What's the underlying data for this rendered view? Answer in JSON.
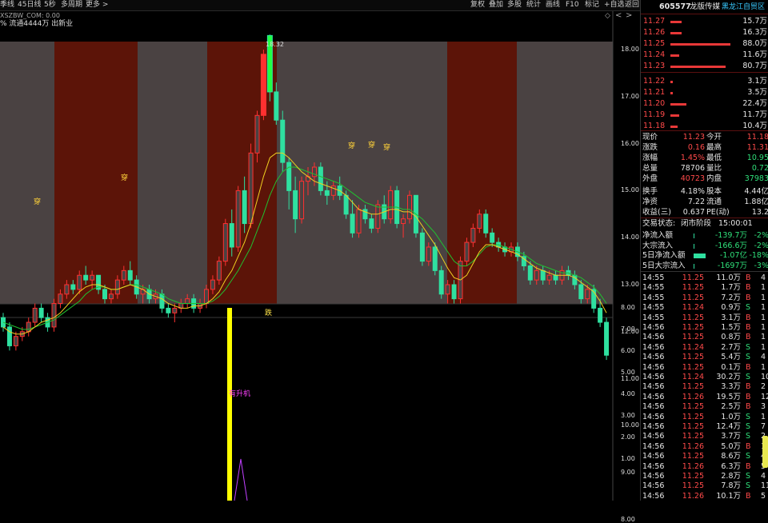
{
  "toolbar": {
    "items_left": [
      "季线",
      "45日线",
      "5秒",
      "多周期",
      "更多 >"
    ],
    "items_right": [
      "复权",
      "叠加",
      "多股",
      "统计",
      "画线",
      "F10",
      "标记",
      "+自选",
      "返回"
    ]
  },
  "formula_line": "XSZBW_COM: 0.00",
  "info_line": "% 流通4444万 出新业",
  "chart": {
    "high_label": "18.32",
    "signal_label": "穿",
    "divider_label": "跌",
    "indicator_label": "有升机",
    "price_ticks": [
      "18.00",
      "17.00",
      "16.00",
      "15.00",
      "14.00",
      "13.00",
      "12.00",
      "11.00",
      "10.00",
      "9.00",
      "8.00"
    ],
    "ind_ticks": [
      "8.00",
      "7.00",
      "6.00",
      "5.00",
      "4.00",
      "3.00",
      "2.00",
      "1.00"
    ]
  },
  "chart_data": {
    "type": "candlestick",
    "ylim": [
      7.5,
      19.0
    ],
    "ohlc": [
      [
        12.3,
        12.4,
        12.0,
        12.1
      ],
      [
        12.1,
        12.2,
        11.6,
        11.7
      ],
      [
        11.7,
        12.0,
        11.6,
        11.9
      ],
      [
        11.9,
        12.1,
        11.8,
        12.0
      ],
      [
        12.0,
        12.3,
        11.9,
        12.2
      ],
      [
        12.2,
        12.6,
        12.1,
        12.5
      ],
      [
        12.5,
        12.6,
        12.2,
        12.3
      ],
      [
        12.3,
        12.4,
        12.0,
        12.1
      ],
      [
        12.1,
        12.7,
        12.0,
        12.6
      ],
      [
        12.6,
        12.9,
        12.5,
        12.8
      ],
      [
        12.8,
        13.1,
        12.7,
        13.0
      ],
      [
        13.0,
        13.1,
        12.8,
        12.9
      ],
      [
        12.9,
        13.3,
        12.8,
        13.2
      ],
      [
        13.2,
        13.4,
        13.0,
        13.1
      ],
      [
        13.1,
        13.3,
        12.9,
        13.2
      ],
      [
        13.2,
        13.2,
        12.8,
        12.9
      ],
      [
        12.9,
        13.0,
        12.6,
        12.7
      ],
      [
        12.7,
        12.9,
        12.6,
        12.8
      ],
      [
        12.8,
        13.2,
        12.7,
        13.1
      ],
      [
        13.1,
        13.4,
        13.0,
        13.3
      ],
      [
        13.3,
        13.5,
        13.0,
        13.1
      ],
      [
        13.1,
        13.2,
        12.7,
        12.8
      ],
      [
        12.8,
        13.0,
        12.6,
        12.9
      ],
      [
        12.9,
        13.0,
        12.6,
        12.7
      ],
      [
        12.7,
        12.9,
        12.6,
        12.8
      ],
      [
        12.8,
        12.9,
        12.4,
        12.5
      ],
      [
        12.5,
        12.6,
        12.3,
        12.4
      ],
      [
        12.4,
        12.6,
        12.2,
        12.5
      ],
      [
        12.5,
        12.7,
        12.4,
        12.6
      ],
      [
        12.6,
        12.8,
        12.5,
        12.7
      ],
      [
        12.7,
        12.8,
        12.4,
        12.5
      ],
      [
        12.5,
        12.7,
        12.4,
        12.6
      ],
      [
        12.6,
        13.0,
        12.5,
        12.9
      ],
      [
        12.9,
        13.2,
        12.8,
        13.1
      ],
      [
        13.1,
        13.6,
        13.0,
        13.5
      ],
      [
        13.5,
        14.4,
        13.4,
        14.3
      ],
      [
        14.3,
        14.6,
        13.6,
        13.8
      ],
      [
        13.8,
        15.1,
        13.7,
        15.0
      ],
      [
        15.0,
        15.3,
        14.1,
        14.3
      ],
      [
        14.3,
        16.0,
        14.2,
        15.8
      ],
      [
        15.8,
        16.7,
        15.6,
        16.6
      ],
      [
        16.6,
        18.0,
        16.5,
        17.9
      ],
      [
        18.3,
        18.32,
        16.9,
        17.1
      ],
      [
        17.1,
        17.3,
        16.4,
        16.5
      ],
      [
        16.5,
        16.7,
        15.4,
        15.6
      ],
      [
        15.6,
        15.7,
        14.6,
        15.0
      ],
      [
        15.0,
        15.3,
        14.1,
        14.4
      ],
      [
        14.4,
        15.3,
        14.3,
        15.2
      ],
      [
        15.2,
        15.5,
        14.9,
        15.3
      ],
      [
        15.3,
        15.6,
        15.1,
        15.5
      ],
      [
        15.5,
        15.6,
        14.9,
        15.0
      ],
      [
        15.0,
        15.2,
        14.7,
        14.9
      ],
      [
        14.9,
        15.2,
        14.8,
        15.1
      ],
      [
        15.1,
        15.3,
        14.8,
        14.9
      ],
      [
        14.9,
        15.0,
        14.4,
        14.5
      ],
      [
        14.5,
        14.8,
        14.0,
        14.1
      ],
      [
        14.1,
        14.7,
        14.0,
        14.6
      ],
      [
        14.6,
        14.7,
        14.3,
        14.4
      ],
      [
        14.4,
        14.5,
        14.1,
        14.2
      ],
      [
        14.2,
        14.8,
        14.1,
        14.7
      ],
      [
        14.7,
        14.9,
        14.3,
        14.4
      ],
      [
        14.4,
        15.1,
        14.3,
        15.0
      ],
      [
        15.0,
        15.1,
        14.2,
        14.3
      ],
      [
        14.3,
        14.5,
        14.0,
        14.4
      ],
      [
        14.4,
        15.0,
        14.3,
        14.9
      ],
      [
        14.9,
        14.9,
        14.0,
        14.1
      ],
      [
        14.1,
        14.2,
        13.4,
        13.5
      ],
      [
        13.5,
        13.9,
        13.4,
        13.8
      ],
      [
        13.8,
        13.9,
        13.2,
        13.3
      ],
      [
        13.3,
        13.4,
        12.7,
        12.8
      ],
      [
        12.8,
        13.1,
        12.6,
        13.0
      ],
      [
        13.0,
        13.1,
        12.6,
        12.7
      ],
      [
        12.7,
        13.6,
        12.6,
        13.5
      ],
      [
        13.5,
        14.0,
        13.4,
        13.9
      ],
      [
        13.9,
        14.3,
        13.8,
        14.2
      ],
      [
        14.2,
        14.6,
        14.1,
        14.5
      ],
      [
        14.5,
        14.6,
        14.0,
        14.1
      ],
      [
        14.1,
        14.2,
        13.8,
        13.9
      ],
      [
        13.9,
        14.0,
        13.7,
        13.8
      ],
      [
        13.8,
        13.9,
        13.6,
        13.7
      ],
      [
        13.7,
        13.9,
        13.6,
        13.8
      ],
      [
        13.8,
        13.9,
        13.5,
        13.6
      ],
      [
        13.6,
        13.7,
        13.3,
        13.4
      ],
      [
        13.4,
        13.5,
        13.0,
        13.1
      ],
      [
        13.1,
        13.4,
        13.0,
        13.3
      ],
      [
        13.3,
        13.4,
        13.0,
        13.1
      ],
      [
        13.1,
        13.3,
        13.0,
        13.2
      ],
      [
        13.2,
        13.3,
        13.0,
        13.1
      ],
      [
        13.1,
        13.4,
        13.0,
        13.3
      ],
      [
        13.3,
        13.4,
        13.1,
        13.2
      ],
      [
        13.2,
        13.3,
        12.9,
        13.0
      ],
      [
        13.0,
        13.1,
        12.6,
        12.7
      ],
      [
        12.7,
        13.0,
        12.6,
        12.9
      ],
      [
        12.9,
        13.0,
        12.4,
        12.5
      ],
      [
        12.5,
        12.7,
        12.1,
        12.2
      ],
      [
        12.2,
        12.3,
        11.4,
        11.5
      ]
    ],
    "ma_fast": [
      12.1,
      12.0,
      11.95,
      11.95,
      12.0,
      12.1,
      12.2,
      12.25,
      12.3,
      12.4,
      12.55,
      12.7,
      12.85,
      12.95,
      13.0,
      13.0,
      12.95,
      12.9,
      12.9,
      12.95,
      13.0,
      12.95,
      12.9,
      12.8,
      12.75,
      12.7,
      12.6,
      12.55,
      12.5,
      12.5,
      12.55,
      12.55,
      12.6,
      12.7,
      12.85,
      13.1,
      13.3,
      13.6,
      13.9,
      14.3,
      14.8,
      15.3,
      15.7,
      15.8,
      15.8,
      15.7,
      15.55,
      15.4,
      15.3,
      15.2,
      15.15,
      15.1,
      15.05,
      15.0,
      14.9,
      14.75,
      14.6,
      14.55,
      14.5,
      14.5,
      14.55,
      14.6,
      14.6,
      14.55,
      14.55,
      14.45,
      14.25,
      14.05,
      13.85,
      13.6,
      13.35,
      13.15,
      13.1,
      13.2,
      13.45,
      13.7,
      13.85,
      13.85,
      13.8,
      13.75,
      13.7,
      13.65,
      13.55,
      13.45,
      13.35,
      13.3,
      13.25,
      13.2,
      13.2,
      13.2,
      13.15,
      13.05,
      12.95,
      12.85,
      12.65,
      12.4
    ],
    "ma_slow": [
      12.2,
      12.15,
      12.1,
      12.05,
      12.05,
      12.1,
      12.15,
      12.2,
      12.25,
      12.35,
      12.45,
      12.55,
      12.65,
      12.8,
      12.9,
      12.95,
      12.95,
      12.9,
      12.9,
      12.95,
      13.0,
      13.0,
      12.95,
      12.9,
      12.85,
      12.8,
      12.7,
      12.65,
      12.6,
      12.6,
      12.6,
      12.6,
      12.6,
      12.65,
      12.75,
      12.9,
      13.1,
      13.3,
      13.55,
      13.8,
      14.15,
      14.5,
      14.9,
      15.2,
      15.4,
      15.5,
      15.5,
      15.45,
      15.4,
      15.35,
      15.3,
      15.25,
      15.2,
      15.15,
      15.05,
      14.95,
      14.85,
      14.75,
      14.7,
      14.65,
      14.65,
      14.65,
      14.65,
      14.6,
      14.6,
      14.5,
      14.4,
      14.25,
      14.1,
      13.9,
      13.7,
      13.5,
      13.4,
      13.4,
      13.5,
      13.65,
      13.8,
      13.85,
      13.85,
      13.8,
      13.75,
      13.7,
      13.65,
      13.55,
      13.45,
      13.4,
      13.35,
      13.3,
      13.25,
      13.25,
      13.2,
      13.15,
      13.05,
      12.95,
      12.8,
      12.6
    ],
    "bands": [
      [
        68,
        172
      ],
      [
        259,
        346
      ],
      [
        559,
        646
      ]
    ],
    "indicator": {
      "spike_x": 287,
      "spike_value": 8.0,
      "triangle_x": 301,
      "triangle_value": 1.0,
      "ylim": [
        0,
        8.6
      ]
    }
  },
  "quote": {
    "code": "605577",
    "name": "龙版传媒",
    "region": "黑龙江自贸区",
    "sells": [
      {
        "price": "11.27",
        "vol": "15.7万",
        "bar": 0.18
      },
      {
        "price": "11.26",
        "vol": "16.3万",
        "bar": 0.19
      },
      {
        "price": "11.25",
        "vol": "88.0万",
        "bar": 1.0
      },
      {
        "price": "11.24",
        "vol": "11.6万",
        "bar": 0.14
      },
      {
        "price": "11.23",
        "vol": "80.7万",
        "bar": 0.92
      }
    ],
    "buys": [
      {
        "price": "11.22",
        "vol": "3.1万",
        "bar": 0.04
      },
      {
        "price": "11.21",
        "vol": "3.5万",
        "bar": 0.04
      },
      {
        "price": "11.20",
        "vol": "22.4万",
        "bar": 0.26
      },
      {
        "price": "11.19",
        "vol": "11.7万",
        "bar": 0.14
      },
      {
        "price": "11.18",
        "vol": "10.4万",
        "bar": 0.12
      }
    ],
    "stats": [
      {
        "l1": "现价",
        "v1": "11.23",
        "c1": "red",
        "l2": "今开",
        "v2": "11.18",
        "c2": "red"
      },
      {
        "l1": "涨跌",
        "v1": "0.16",
        "c1": "red",
        "l2": "最高",
        "v2": "11.31",
        "c2": "red"
      },
      {
        "l1": "涨幅",
        "v1": "1.45%",
        "c1": "red",
        "l2": "最低",
        "v2": "10.95",
        "c2": "green"
      },
      {
        "l1": "总量",
        "v1": "78706",
        "c1": "white",
        "l2": "量比",
        "v2": "0.72",
        "c2": "green"
      },
      {
        "l1": "外盘",
        "v1": "40723",
        "c1": "red",
        "l2": "内盘",
        "v2": "37983",
        "c2": "green"
      },
      {
        "l1": "换手",
        "v1": "4.18%",
        "c1": "white",
        "l2": "股本",
        "v2": "4.44亿",
        "c2": "white"
      },
      {
        "l1": "净资",
        "v1": "7.22",
        "c1": "white",
        "l2": "流通",
        "v2": "1.88亿",
        "c2": "white"
      },
      {
        "l1": "收益(三)",
        "v1": "0.637",
        "c1": "white",
        "l2": "PE(动)",
        "v2": "13.2",
        "c2": "white"
      }
    ],
    "status_label": "交易状态:",
    "status_value": "闭市阶段",
    "status_time": "15:00:01",
    "flows": [
      {
        "label": "净流入额",
        "value": "-139.7万",
        "pct": "-2%",
        "bar": 0
      },
      {
        "label": "大宗流入",
        "value": "-166.6万",
        "pct": "-2%",
        "bar": 0
      },
      {
        "label": "5日净流入额",
        "value": "-1.07亿",
        "pct": "-18%",
        "bar": 1
      },
      {
        "label": "5日大宗流入",
        "value": "-1697万",
        "pct": "-3%",
        "bar": 0
      }
    ],
    "ticks": [
      {
        "t": "14:55",
        "p": "11.25",
        "v": "11.0万",
        "s": "B",
        "n": "4"
      },
      {
        "t": "14:55",
        "p": "11.25",
        "v": "1.7万",
        "s": "B",
        "n": "1"
      },
      {
        "t": "14:55",
        "p": "11.25",
        "v": "7.2万",
        "s": "B",
        "n": "1"
      },
      {
        "t": "14:55",
        "p": "11.24",
        "v": "0.9万",
        "s": "S",
        "n": "1"
      },
      {
        "t": "14:55",
        "p": "11.25",
        "v": "3.1万",
        "s": "B",
        "n": "1"
      },
      {
        "t": "14:56",
        "p": "11.25",
        "v": "1.5万",
        "s": "B",
        "n": "1"
      },
      {
        "t": "14:56",
        "p": "11.25",
        "v": "0.8万",
        "s": "B",
        "n": "1"
      },
      {
        "t": "14:56",
        "p": "11.24",
        "v": "2.7万",
        "s": "S",
        "n": "1"
      },
      {
        "t": "14:56",
        "p": "11.25",
        "v": "5.4万",
        "s": "S",
        "n": "4"
      },
      {
        "t": "14:56",
        "p": "11.25",
        "v": "0.1万",
        "s": "B",
        "n": "1"
      },
      {
        "t": "14:56",
        "p": "11.24",
        "v": "30.2万",
        "s": "S",
        "n": "10"
      },
      {
        "t": "14:56",
        "p": "11.25",
        "v": "3.3万",
        "s": "B",
        "n": "2"
      },
      {
        "t": "14:56",
        "p": "11.26",
        "v": "19.5万",
        "s": "B",
        "n": "12"
      },
      {
        "t": "14:56",
        "p": "11.25",
        "v": "2.5万",
        "s": "B",
        "n": "3"
      },
      {
        "t": "14:56",
        "p": "11.25",
        "v": "1.0万",
        "s": "S",
        "n": "1"
      },
      {
        "t": "14:56",
        "p": "11.25",
        "v": "12.4万",
        "s": "S",
        "n": "7"
      },
      {
        "t": "14:56",
        "p": "11.25",
        "v": "3.7万",
        "s": "S",
        "n": "2"
      },
      {
        "t": "14:56",
        "p": "11.26",
        "v": "5.0万",
        "s": "B",
        "n": "1"
      },
      {
        "t": "14:56",
        "p": "11.25",
        "v": "8.6万",
        "s": "S",
        "n": "4"
      },
      {
        "t": "14:56",
        "p": "11.26",
        "v": "6.3万",
        "s": "B",
        "n": "5"
      },
      {
        "t": "14:56",
        "p": "11.25",
        "v": "2.8万",
        "s": "S",
        "n": "4"
      },
      {
        "t": "14:56",
        "p": "11.25",
        "v": "7.8万",
        "s": "S",
        "n": "11"
      },
      {
        "t": "14:56",
        "p": "11.26",
        "v": "10.1万",
        "s": "B",
        "n": "5"
      }
    ]
  }
}
